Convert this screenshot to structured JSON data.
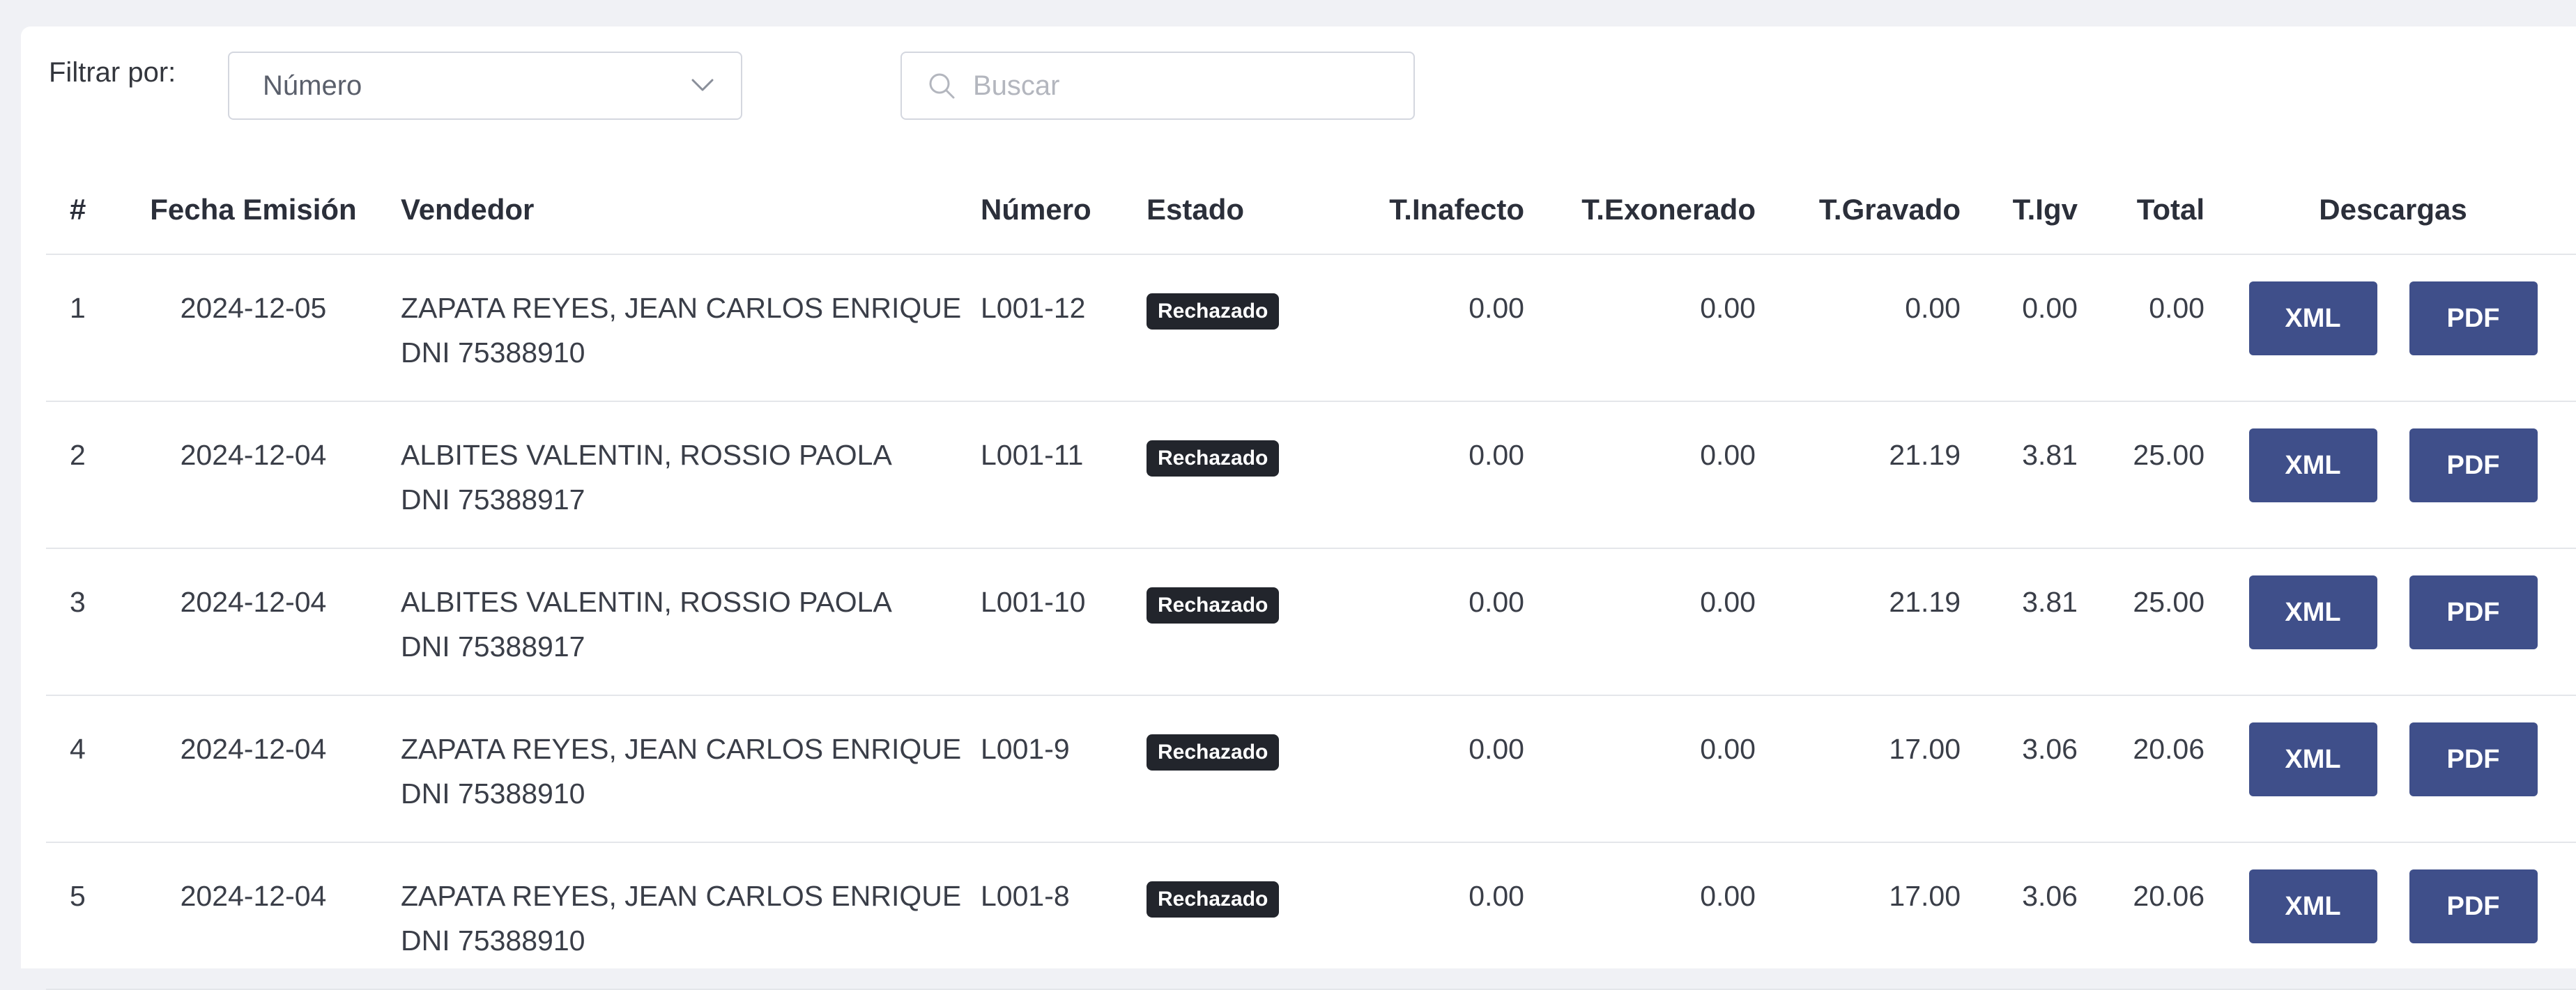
{
  "filter": {
    "label": "Filtrar por:",
    "selected": "Número",
    "search_placeholder": "Buscar"
  },
  "table": {
    "headers": {
      "idx": "#",
      "fecha": "Fecha Emisión",
      "vendedor": "Vendedor",
      "numero": "Número",
      "estado": "Estado",
      "inafecto": "T.Inafecto",
      "exonerado": "T.Exonerado",
      "gravado": "T.Gravado",
      "igv": "T.Igv",
      "total": "Total",
      "descargas": "Descargas"
    },
    "rows": [
      {
        "idx": "1",
        "fecha": "2024-12-05",
        "vendedor": "ZAPATA REYES, JEAN CARLOS ENRIQUE",
        "dni": "DNI 75388910",
        "numero": "L001-12",
        "estado": "Rechazado",
        "inafecto": "0.00",
        "exonerado": "0.00",
        "gravado": "0.00",
        "igv": "0.00",
        "total": "0.00",
        "xml": "XML",
        "pdf": "PDF"
      },
      {
        "idx": "2",
        "fecha": "2024-12-04",
        "vendedor": "ALBITES VALENTIN, ROSSIO PAOLA",
        "dni": "DNI 75388917",
        "numero": "L001-11",
        "estado": "Rechazado",
        "inafecto": "0.00",
        "exonerado": "0.00",
        "gravado": "21.19",
        "igv": "3.81",
        "total": "25.00",
        "xml": "XML",
        "pdf": "PDF"
      },
      {
        "idx": "3",
        "fecha": "2024-12-04",
        "vendedor": "ALBITES VALENTIN, ROSSIO PAOLA",
        "dni": "DNI 75388917",
        "numero": "L001-10",
        "estado": "Rechazado",
        "inafecto": "0.00",
        "exonerado": "0.00",
        "gravado": "21.19",
        "igv": "3.81",
        "total": "25.00",
        "xml": "XML",
        "pdf": "PDF"
      },
      {
        "idx": "4",
        "fecha": "2024-12-04",
        "vendedor": "ZAPATA REYES, JEAN CARLOS ENRIQUE",
        "dni": "DNI 75388910",
        "numero": "L001-9",
        "estado": "Rechazado",
        "inafecto": "0.00",
        "exonerado": "0.00",
        "gravado": "17.00",
        "igv": "3.06",
        "total": "20.06",
        "xml": "XML",
        "pdf": "PDF"
      },
      {
        "idx": "5",
        "fecha": "2024-12-04",
        "vendedor": "ZAPATA REYES, JEAN CARLOS ENRIQUE",
        "dni": "DNI 75388910",
        "numero": "L001-8",
        "estado": "Rechazado",
        "inafecto": "0.00",
        "exonerado": "0.00",
        "gravado": "17.00",
        "igv": "3.06",
        "total": "20.06",
        "xml": "XML",
        "pdf": "PDF"
      }
    ]
  },
  "colors": {
    "button": "#3f4f8a",
    "badge": "#22252c",
    "page_bg": "#f0f1f5"
  },
  "icons": {
    "select_chevron": "chevron-down-icon",
    "search": "search-icon"
  }
}
